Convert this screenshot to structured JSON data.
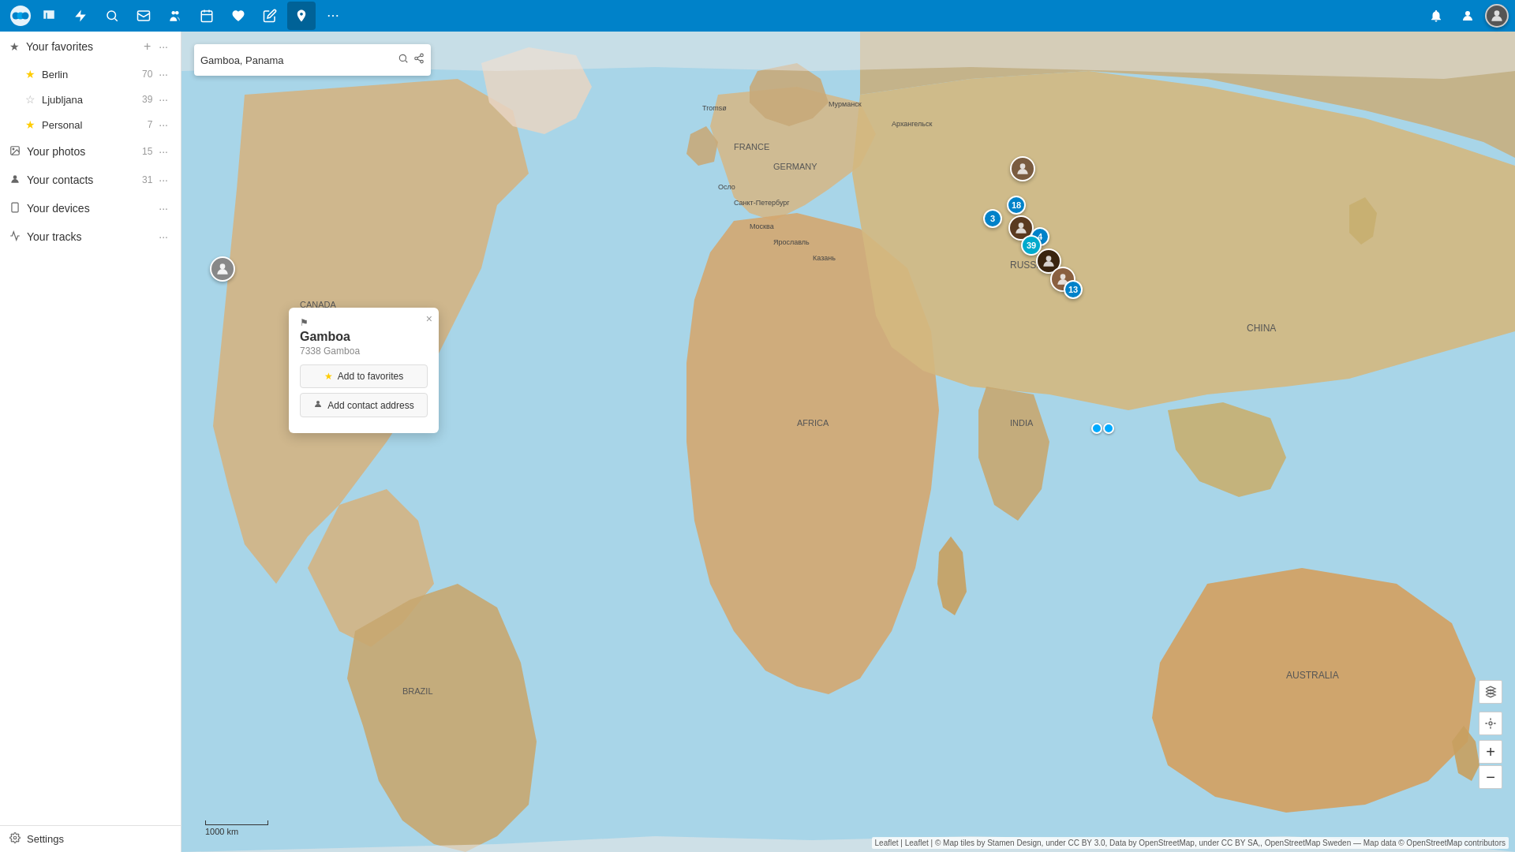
{
  "topnav": {
    "logo_alt": "Nextcloud",
    "icons": [
      {
        "name": "files-icon",
        "symbol": "🗂",
        "label": "Files"
      },
      {
        "name": "activity-icon",
        "symbol": "⚡",
        "label": "Activity"
      },
      {
        "name": "search-icon",
        "symbol": "🔍",
        "label": "Search"
      },
      {
        "name": "mail-icon",
        "symbol": "✉",
        "label": "Mail"
      },
      {
        "name": "contacts-icon",
        "symbol": "👥",
        "label": "Contacts"
      },
      {
        "name": "calendar-icon",
        "symbol": "📅",
        "label": "Calendar"
      },
      {
        "name": "heart-icon",
        "symbol": "♥",
        "label": "Favorites"
      },
      {
        "name": "edit-icon",
        "symbol": "✏",
        "label": "Edit"
      },
      {
        "name": "map-icon",
        "symbol": "📍",
        "label": "Maps",
        "active": true
      },
      {
        "name": "more-icon",
        "symbol": "•••",
        "label": "More"
      }
    ],
    "right_icons": [
      {
        "name": "notifications-icon",
        "symbol": "🔔"
      },
      {
        "name": "contacts-small-icon",
        "symbol": "👤"
      },
      {
        "name": "user-avatar",
        "symbol": "👤"
      }
    ]
  },
  "sidebar": {
    "favorites": {
      "title": "Your favorites",
      "items": [
        {
          "name": "Berlin",
          "count": 70,
          "star": "filled"
        },
        {
          "name": "Ljubljana",
          "count": 39,
          "star": "outline"
        },
        {
          "name": "Personal",
          "count": 7,
          "star": "filled"
        }
      ]
    },
    "photos": {
      "title": "Your photos",
      "count": 15
    },
    "contacts": {
      "title": "Your contacts",
      "count": 31
    },
    "devices": {
      "title": "Your devices",
      "count": null
    },
    "tracks": {
      "title": "Your tracks",
      "count": null
    },
    "settings": {
      "label": "Settings"
    }
  },
  "map": {
    "search_value": "Gamboa, Panama",
    "search_placeholder": "Search",
    "scale_label": "1000 km",
    "attribution": "Leaflet | Leaflet | © Map tiles by Stamen Design, under CC BY 3.0, Data by OpenStreetMap, under CC BY SA,, OpenStreetMap Sweden — Map data © OpenStreetMap contributors"
  },
  "popup": {
    "location_icon": "⚑",
    "title": "Gamboa",
    "subtitle": "7338 Gamboa",
    "close_icon": "×",
    "add_to_favorites_label": "Add to favorites",
    "add_contact_address_label": "Add contact address"
  }
}
